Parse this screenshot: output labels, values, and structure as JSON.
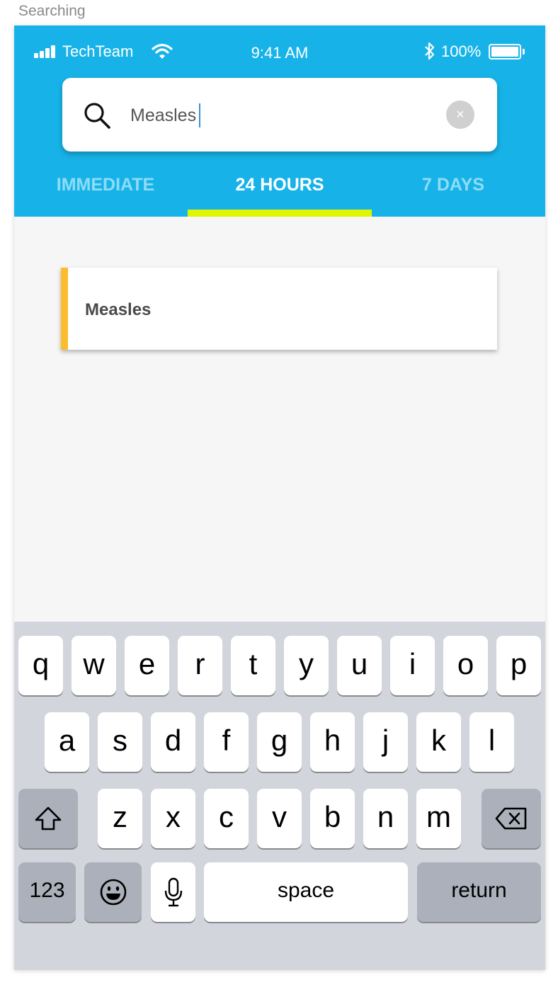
{
  "frame_title": "Searching",
  "status_bar": {
    "carrier": "TechTeam",
    "time": "9:41 AM",
    "battery": "100%",
    "icons": [
      "signal-icon",
      "wifi-icon",
      "bluetooth-icon",
      "battery-icon"
    ]
  },
  "search": {
    "value": "Measles",
    "clear_symbol": "×"
  },
  "tabs": [
    {
      "label": "IMMEDIATE",
      "active": false
    },
    {
      "label": "24 HOURS",
      "active": true
    },
    {
      "label": "7 DAYS",
      "active": false
    }
  ],
  "results": [
    {
      "label": "Measles"
    }
  ],
  "keyboard": {
    "row1": [
      "q",
      "w",
      "e",
      "r",
      "t",
      "y",
      "u",
      "i",
      "o",
      "p"
    ],
    "row2": [
      "a",
      "s",
      "d",
      "f",
      "g",
      "h",
      "j",
      "k",
      "l"
    ],
    "row3": [
      "z",
      "x",
      "c",
      "v",
      "b",
      "n",
      "m"
    ],
    "numbers_label": "123",
    "space_label": "space",
    "return_label": "return"
  },
  "colors": {
    "header": "#17b3e8",
    "tab_indicator": "#dff600",
    "result_accent": "#fbbd2d",
    "keyboard_bg": "#d2d5db"
  }
}
